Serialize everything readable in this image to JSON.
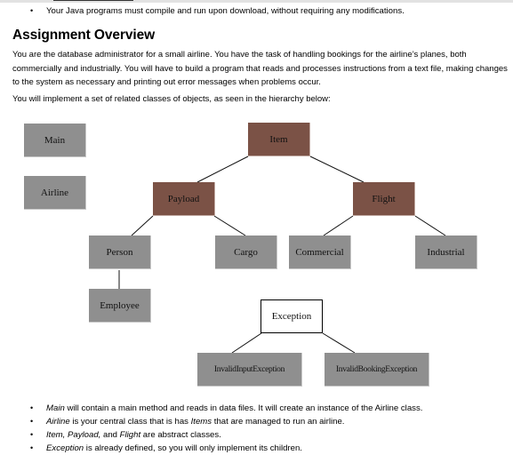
{
  "top_bullet": "Your Java programs must compile and run upon download, without requiring any modifications.",
  "heading": "Assignment Overview",
  "intro_paragraph": "You are the database administrator for a small airline. You have the task of handling bookings for the airline’s planes, both commercially and industrially. You will have to build a program that reads and processes instructions from a text file, making changes to the system as necessary and printing out error messages when problems occur.",
  "intro_line2": "You will implement a set of related classes of objects, as seen in the hierarchy below:",
  "diagram": {
    "colors": {
      "concrete": "#8f8f8f",
      "abstract": "#7b5246",
      "predefined": "#ffffff"
    },
    "nodes": {
      "main": "Main",
      "airline": "Airline",
      "item": "Item",
      "payload": "Payload",
      "flight": "Flight",
      "person": "Person",
      "cargo": "Cargo",
      "commercial": "Commercial",
      "industrial": "Industrial",
      "employee": "Employee",
      "exception": "Exception",
      "invalid_input": "InvalidInputException",
      "invalid_booking": "InvalidBookingException"
    },
    "edges": [
      [
        "item",
        "payload"
      ],
      [
        "item",
        "flight"
      ],
      [
        "payload",
        "person"
      ],
      [
        "payload",
        "cargo"
      ],
      [
        "flight",
        "commercial"
      ],
      [
        "flight",
        "industrial"
      ],
      [
        "person",
        "employee"
      ],
      [
        "exception",
        "invalid_input"
      ],
      [
        "exception",
        "invalid_booking"
      ]
    ]
  },
  "bullets": [
    {
      "em": "Main",
      "rest": " will contain a main method and reads in data files. It will create an instance of the Airline class."
    },
    {
      "em": "Airline",
      "mid": " is your central class that is has ",
      "em2": "Items",
      "rest": " that are managed to run an airline."
    },
    {
      "em": "Item, Payload,",
      "mid": " and ",
      "em2": "Flight",
      "rest": " are abstract classes."
    },
    {
      "em": "Exception",
      "rest": " is already defined, so you will only implement its children."
    }
  ],
  "bullet_glyph": "•"
}
